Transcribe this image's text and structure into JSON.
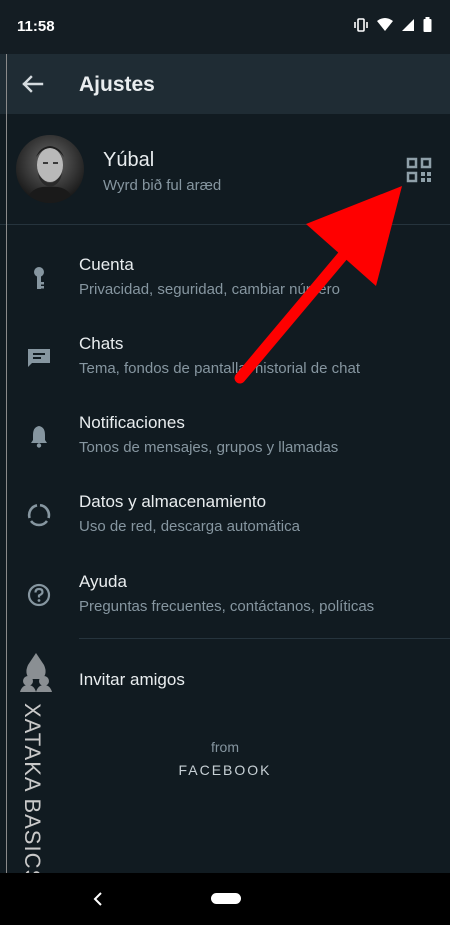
{
  "status_bar": {
    "time": "11:58"
  },
  "app_bar": {
    "title": "Ajustes"
  },
  "profile": {
    "name": "Yúbal",
    "status": "Wyrd bið ful aræd"
  },
  "menu": [
    {
      "title": "Cuenta",
      "subtitle": "Privacidad, seguridad, cambiar número",
      "icon": "key-icon"
    },
    {
      "title": "Chats",
      "subtitle": "Tema, fondos de pantalla, historial de chat",
      "icon": "chat-icon"
    },
    {
      "title": "Notificaciones",
      "subtitle": "Tonos de mensajes, grupos y llamadas",
      "icon": "bell-icon"
    },
    {
      "title": "Datos y almacenamiento",
      "subtitle": "Uso de red, descarga automática",
      "icon": "data-usage-icon"
    },
    {
      "title": "Ayuda",
      "subtitle": "Preguntas frecuentes, contáctanos, políticas",
      "icon": "help-icon"
    }
  ],
  "invite": {
    "label": "Invitar amigos"
  },
  "footer": {
    "from": "from",
    "brand": "FACEBOOK"
  },
  "watermark": {
    "text": "XATAKA BASICS"
  },
  "colors": {
    "background": "#111b21",
    "app_bar": "#1f2c34",
    "icon": "#8696a0",
    "annotation_arrow": "#ff0000"
  }
}
